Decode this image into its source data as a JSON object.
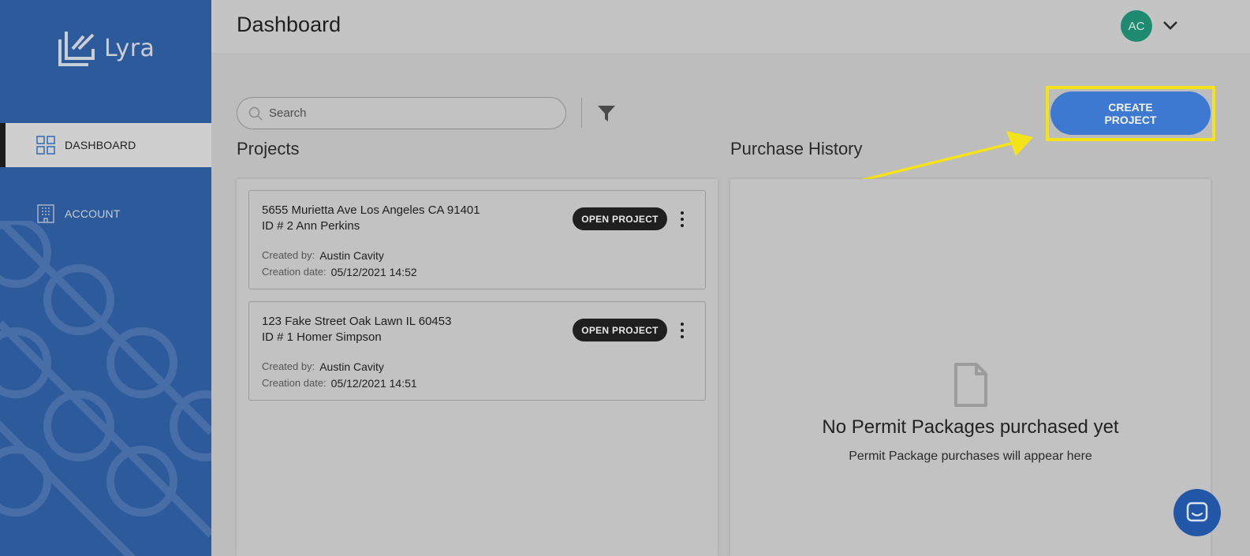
{
  "brand": {
    "name": "Lyra"
  },
  "sidebar": {
    "items": [
      {
        "label": "DASHBOARD",
        "icon": "grid-icon",
        "active": true
      },
      {
        "label": "ACCOUNT",
        "icon": "building-icon",
        "active": false
      }
    ]
  },
  "header": {
    "title": "Dashboard",
    "avatar_initials": "AC"
  },
  "toolbar": {
    "search_placeholder": "Search",
    "create_label_line1": "CREATE",
    "create_label_line2": "PROJECT"
  },
  "projects": {
    "title": "Projects",
    "cards": [
      {
        "address": "5655 Murietta Ave Los Angeles CA 91401",
        "id_line": "ID # 2 Ann Perkins",
        "created_by_label": "Created by:",
        "created_by": "Austin Cavity",
        "creation_date_label": "Creation date:",
        "creation_date": "05/12/2021 14:52",
        "open_label": "OPEN PROJECT"
      },
      {
        "address": "123 Fake Street Oak Lawn IL 60453",
        "id_line": "ID # 1 Homer Simpson",
        "created_by_label": "Created by:",
        "created_by": "Austin Cavity",
        "creation_date_label": "Creation date:",
        "creation_date": "05/12/2021 14:51",
        "open_label": "OPEN PROJECT"
      }
    ]
  },
  "purchase_history": {
    "title": "Purchase History",
    "empty_title": "No Permit Packages purchased yet",
    "empty_subtitle": "Permit Package purchases will appear here"
  },
  "colors": {
    "sidebar": "#2d5a9a",
    "primary_button": "#3d79d0",
    "highlight": "#f5e31a",
    "avatar": "#1e8a6f"
  }
}
